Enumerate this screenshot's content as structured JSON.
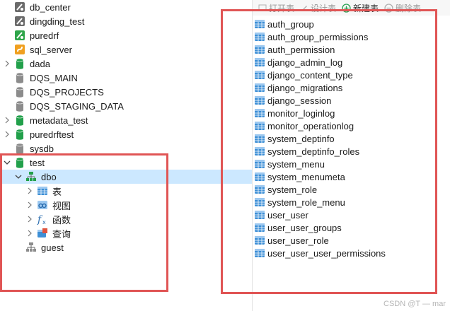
{
  "toolbar": {
    "open_table": "打开表",
    "design_table": "设计表",
    "new_table": "新建表",
    "delete_table": "删除表"
  },
  "tree": [
    {
      "label": "db_center",
      "icon": "sql-file-icon",
      "expand": "none",
      "indent": 0
    },
    {
      "label": "dingding_test",
      "icon": "sql-file-icon",
      "expand": "none",
      "indent": 0
    },
    {
      "label": "puredrf",
      "icon": "sqlite-icon",
      "expand": "none",
      "indent": 0
    },
    {
      "label": "sql_server",
      "icon": "sql-server-icon",
      "expand": "none",
      "indent": 0
    },
    {
      "label": "dada",
      "icon": "database-green-icon",
      "expand": "collapsed",
      "indent": 0
    },
    {
      "label": "DQS_MAIN",
      "icon": "database-gray-icon",
      "expand": "none",
      "indent": 0
    },
    {
      "label": "DQS_PROJECTS",
      "icon": "database-gray-icon",
      "expand": "none",
      "indent": 0
    },
    {
      "label": "DQS_STAGING_DATA",
      "icon": "database-gray-icon",
      "expand": "none",
      "indent": 0
    },
    {
      "label": "metadata_test",
      "icon": "database-green-icon",
      "expand": "collapsed",
      "indent": 0
    },
    {
      "label": "puredrftest",
      "icon": "database-green-icon",
      "expand": "collapsed",
      "indent": 0
    },
    {
      "label": "sysdb",
      "icon": "database-gray-icon",
      "expand": "none",
      "indent": 0
    },
    {
      "label": "test",
      "icon": "database-green-icon",
      "expand": "expanded",
      "indent": 0
    },
    {
      "label": "dbo",
      "icon": "schema-icon",
      "expand": "expanded",
      "indent": 1,
      "selected": true
    },
    {
      "label": "表",
      "icon": "table-icon",
      "expand": "collapsed",
      "indent": 2
    },
    {
      "label": "视图",
      "icon": "view-icon",
      "expand": "collapsed",
      "indent": 2
    },
    {
      "label": "函数",
      "icon": "function-icon",
      "expand": "collapsed",
      "indent": 2
    },
    {
      "label": "查询",
      "icon": "query-icon",
      "expand": "collapsed",
      "indent": 2
    },
    {
      "label": "guest",
      "icon": "schema-gray-icon",
      "expand": "none",
      "indent": 1
    }
  ],
  "tables": [
    "auth_group",
    "auth_group_permissions",
    "auth_permission",
    "django_admin_log",
    "django_content_type",
    "django_migrations",
    "django_session",
    "monitor_loginlog",
    "monitor_operationlog",
    "system_deptinfo",
    "system_deptinfo_roles",
    "system_menu",
    "system_menumeta",
    "system_role",
    "system_role_menu",
    "user_user",
    "user_user_groups",
    "user_user_role",
    "user_user_user_permissions"
  ],
  "colors": {
    "selection": "#cce8ff",
    "highlight_box": "#e05555",
    "db_green": "#22a04b",
    "db_gray": "#8c8c8c",
    "table_blue": "#3d8fd6"
  },
  "watermark": "CSDN @T — mar"
}
